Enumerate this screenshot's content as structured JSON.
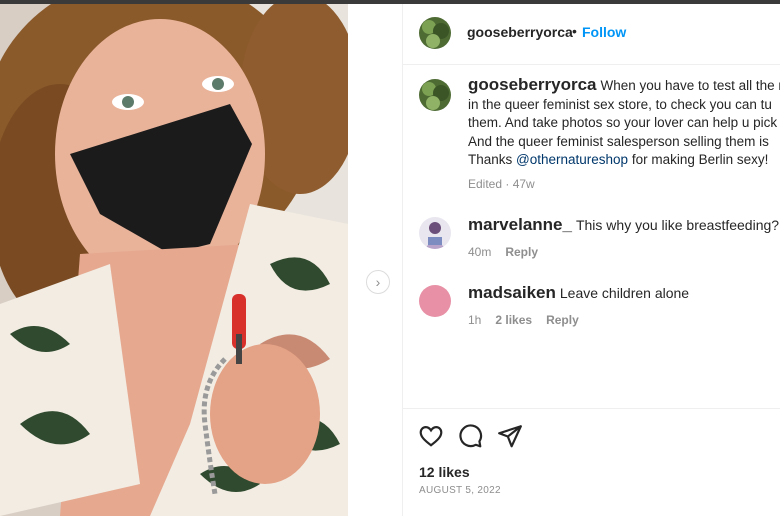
{
  "post": {
    "author": "gooseberryorca",
    "separator": "•",
    "follow_label": "Follow"
  },
  "caption": {
    "author": "gooseberryorca",
    "line1": "When you have to test all the r",
    "line2": "in the queer feminist sex store, to check you can tu",
    "line3": "them. And take photos so your lover can help u pick",
    "line4": "And the queer feminist salesperson selling them is",
    "line5_prefix": "Thanks ",
    "mention": "@othernatureshop",
    "line5_suffix": " for making Berlin sexy!",
    "meta": "Edited · 47w"
  },
  "comments": [
    {
      "author": "marvelanne_",
      "text": "This why you like breastfeeding?",
      "time": "40m",
      "likes": "",
      "reply": "Reply"
    },
    {
      "author": "madsaiken",
      "text": "Leave children alone",
      "time": "1h",
      "likes": "2 likes",
      "reply": "Reply"
    }
  ],
  "actions": {
    "likes": "12 likes",
    "date": "AUGUST 5, 2022"
  },
  "icons": {
    "next": "chevron-right-icon",
    "like": "heart-icon",
    "comment": "comment-icon",
    "share": "paper-plane-icon"
  },
  "colors": {
    "link": "#0095f6",
    "mention": "#00376b",
    "muted": "#8e8e8e",
    "avatar_pink": "#e790a6"
  }
}
